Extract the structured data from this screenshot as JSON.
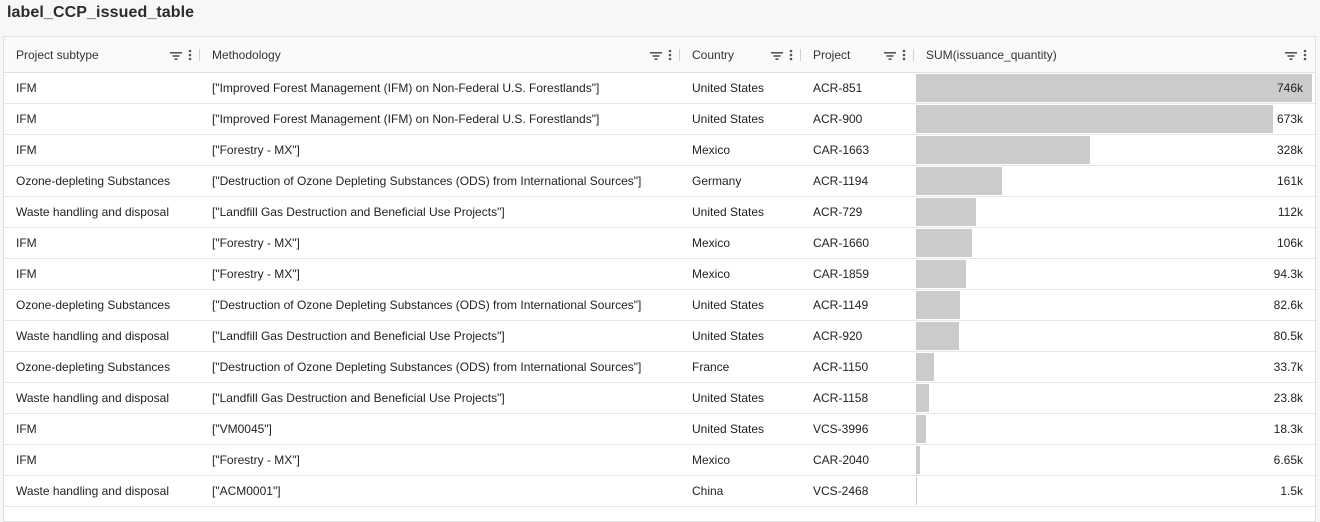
{
  "title": "label_CCP_issued_table",
  "columns": [
    {
      "label": "Project subtype"
    },
    {
      "label": "Methodology"
    },
    {
      "label": "Country"
    },
    {
      "label": "Project"
    },
    {
      "label": "SUM(issuance_quantity)"
    }
  ],
  "bar_color": "#cbcbcb",
  "bar_max": 746000,
  "rows": [
    {
      "subtype": "IFM",
      "methodology": "[\"Improved Forest Management (IFM) on Non-Federal U.S. Forestlands\"]",
      "country": "United States",
      "project": "ACR-851",
      "sum": "746k",
      "value": 746000
    },
    {
      "subtype": "IFM",
      "methodology": "[\"Improved Forest Management (IFM) on Non-Federal U.S. Forestlands\"]",
      "country": "United States",
      "project": "ACR-900",
      "sum": "673k",
      "value": 673000
    },
    {
      "subtype": "IFM",
      "methodology": "[\"Forestry - MX\"]",
      "country": "Mexico",
      "project": "CAR-1663",
      "sum": "328k",
      "value": 328000
    },
    {
      "subtype": "Ozone-depleting Substances",
      "methodology": "[\"Destruction of Ozone Depleting Substances (ODS) from International Sources\"]",
      "country": "Germany",
      "project": "ACR-1194",
      "sum": "161k",
      "value": 161000
    },
    {
      "subtype": "Waste handling and disposal",
      "methodology": "[\"Landfill Gas Destruction and Beneficial Use Projects\"]",
      "country": "United States",
      "project": "ACR-729",
      "sum": "112k",
      "value": 112000
    },
    {
      "subtype": "IFM",
      "methodology": "[\"Forestry - MX\"]",
      "country": "Mexico",
      "project": "CAR-1660",
      "sum": "106k",
      "value": 106000
    },
    {
      "subtype": "IFM",
      "methodology": "[\"Forestry - MX\"]",
      "country": "Mexico",
      "project": "CAR-1859",
      "sum": "94.3k",
      "value": 94300
    },
    {
      "subtype": "Ozone-depleting Substances",
      "methodology": "[\"Destruction of Ozone Depleting Substances (ODS) from International Sources\"]",
      "country": "United States",
      "project": "ACR-1149",
      "sum": "82.6k",
      "value": 82600
    },
    {
      "subtype": "Waste handling and disposal",
      "methodology": "[\"Landfill Gas Destruction and Beneficial Use Projects\"]",
      "country": "United States",
      "project": "ACR-920",
      "sum": "80.5k",
      "value": 80500
    },
    {
      "subtype": "Ozone-depleting Substances",
      "methodology": "[\"Destruction of Ozone Depleting Substances (ODS) from International Sources\"]",
      "country": "France",
      "project": "ACR-1150",
      "sum": "33.7k",
      "value": 33700
    },
    {
      "subtype": "Waste handling and disposal",
      "methodology": "[\"Landfill Gas Destruction and Beneficial Use Projects\"]",
      "country": "United States",
      "project": "ACR-1158",
      "sum": "23.8k",
      "value": 23800
    },
    {
      "subtype": "IFM",
      "methodology": "[\"VM0045\"]",
      "country": "United States",
      "project": "VCS-3996",
      "sum": "18.3k",
      "value": 18300
    },
    {
      "subtype": "IFM",
      "methodology": "[\"Forestry - MX\"]",
      "country": "Mexico",
      "project": "CAR-2040",
      "sum": "6.65k",
      "value": 6650
    },
    {
      "subtype": "Waste handling and disposal",
      "methodology": "[\"ACM0001\"]",
      "country": "China",
      "project": "VCS-2468",
      "sum": "1.5k",
      "value": 1500
    }
  ]
}
